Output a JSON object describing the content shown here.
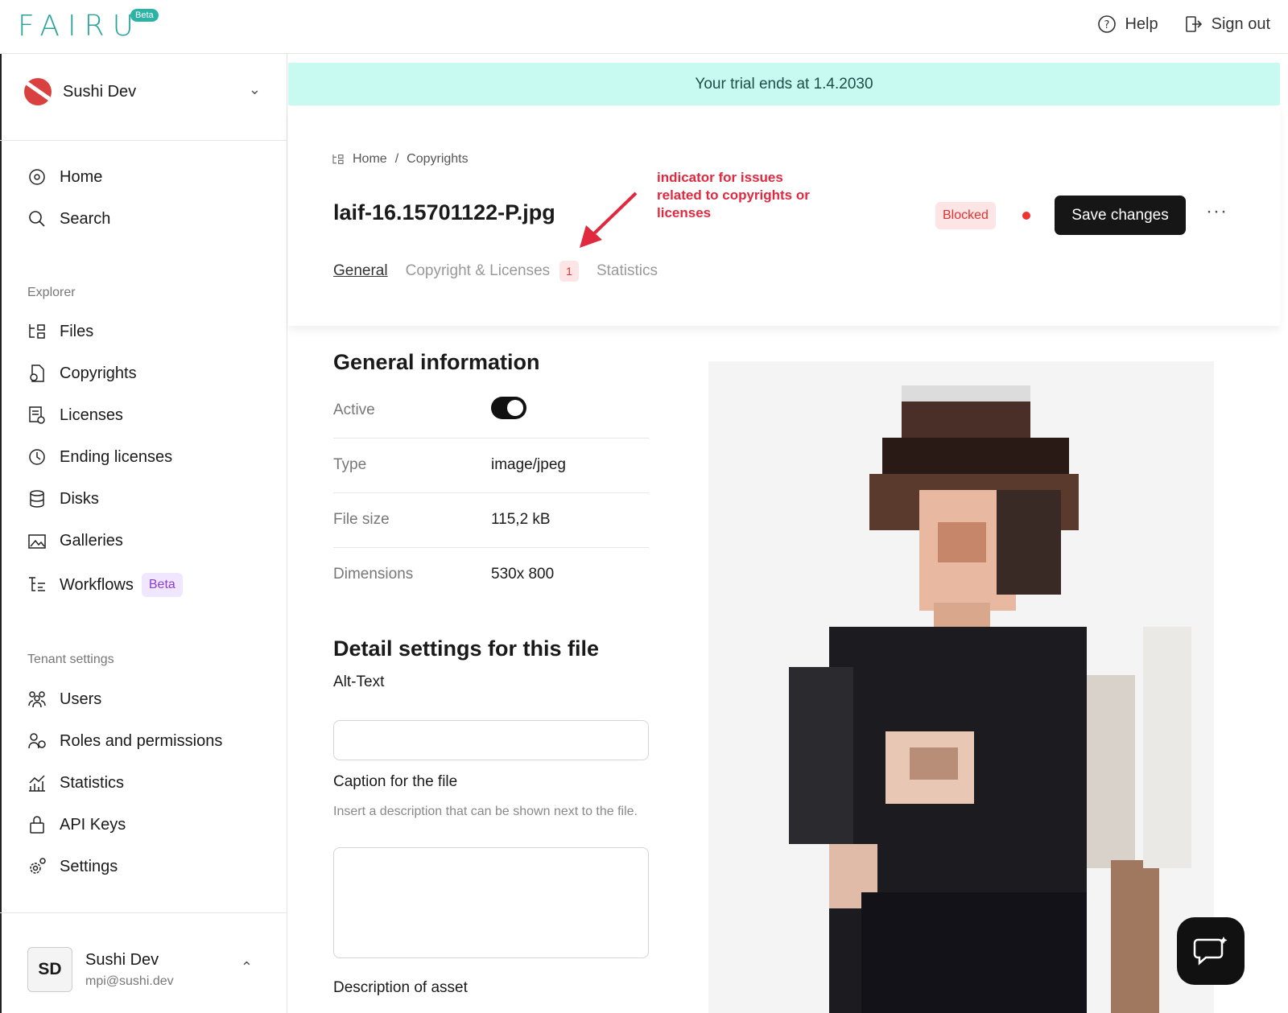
{
  "topbar": {
    "logo": "FAIRU",
    "logo_badge": "Beta",
    "help_label": "Help",
    "signout_label": "Sign out"
  },
  "sidebar": {
    "org_name": "Sushi Dev",
    "nav_home": "Home",
    "nav_search": "Search",
    "explorer_label": "Explorer",
    "explorer": [
      "Files",
      "Copyrights",
      "Licenses",
      "Ending licenses",
      "Disks",
      "Galleries",
      "Workflows"
    ],
    "workflows_badge": "Beta",
    "tenant_label": "Tenant settings",
    "tenant": [
      "Users",
      "Roles and permissions",
      "Statistics",
      "API Keys",
      "Settings"
    ],
    "user": {
      "initials": "SD",
      "name": "Sushi Dev",
      "email": "mpi@sushi.dev"
    }
  },
  "trial_banner": "Your trial ends at 1.4.2030",
  "header": {
    "breadcrumb": [
      "Home",
      "/",
      "Copyrights"
    ],
    "file_title": "laif-16.15701122-P.jpg",
    "annotation": "indicator for issues related to copyrights or licenses",
    "status_badge": "Blocked",
    "save_label": "Save changes",
    "more_label": "···",
    "tabs": [
      "General",
      "Copyright & Licenses",
      "Statistics"
    ],
    "tab_badge": "1"
  },
  "general": {
    "heading": "General information",
    "rows": [
      {
        "key": "Active",
        "value": ""
      },
      {
        "key": "Type",
        "value": "image/jpeg"
      },
      {
        "key": "File size",
        "value": "115,2 kB"
      },
      {
        "key": "Dimensions",
        "value": "530x 800"
      }
    ]
  },
  "detail": {
    "heading": "Detail settings for this file",
    "alt_label": "Alt-Text",
    "caption_label": "Caption for the file",
    "caption_hint": "Insert a description that can be shown next to the file.",
    "description_label": "Description of asset"
  },
  "colors": {
    "accent": "#2aa39a",
    "trial_bg": "#c8faf2",
    "danger": "#e0293f",
    "primary_btn": "#161616"
  }
}
